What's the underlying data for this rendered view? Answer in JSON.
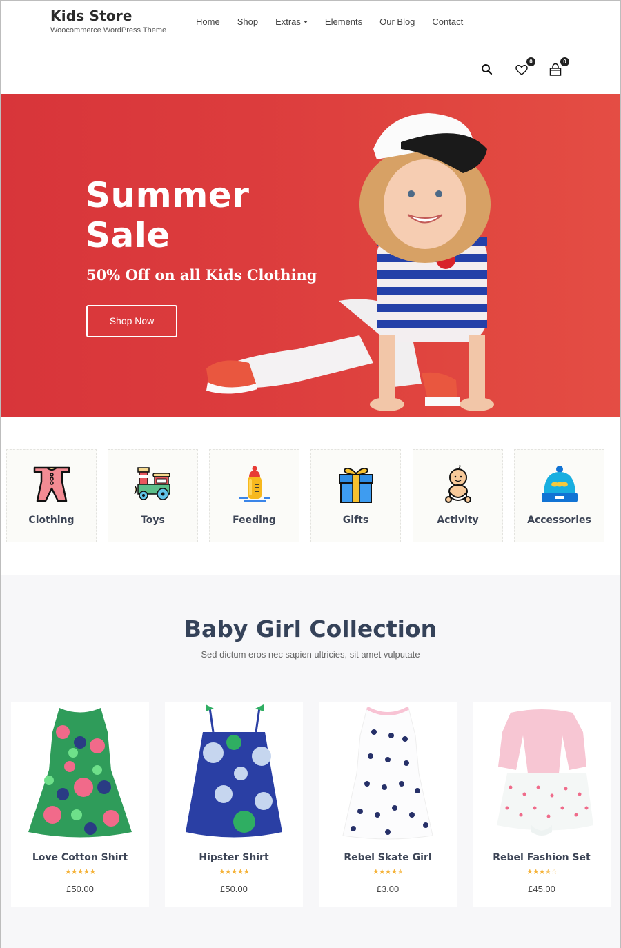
{
  "brand": {
    "title": "Kids Store",
    "subtitle": "Woocommerce WordPress Theme"
  },
  "nav": [
    {
      "label": "Home"
    },
    {
      "label": "Shop"
    },
    {
      "label": "Extras",
      "has_dropdown": true
    },
    {
      "label": "Elements"
    },
    {
      "label": "Our Blog"
    },
    {
      "label": "Contact"
    }
  ],
  "header_icons": {
    "search": "search-icon",
    "wishlist": {
      "icon": "heart-icon",
      "count": "0"
    },
    "cart": {
      "icon": "shopping-bag-icon",
      "count": "0"
    }
  },
  "hero": {
    "title_line1": "Summer",
    "title_line2": "Sale",
    "subtitle": "50% Off on all Kids Clothing",
    "button": "Shop Now",
    "background_color": "#dc3c3d"
  },
  "categories": [
    {
      "label": "Clothing",
      "icon": "onesie-icon"
    },
    {
      "label": "Toys",
      "icon": "toy-train-icon"
    },
    {
      "label": "Feeding",
      "icon": "baby-bottle-icon"
    },
    {
      "label": "Gifts",
      "icon": "gift-box-icon"
    },
    {
      "label": "Activity",
      "icon": "baby-icon"
    },
    {
      "label": "Accessories",
      "icon": "beanie-hat-icon"
    }
  ],
  "collection": {
    "title": "Baby Girl Collection",
    "subtitle": "Sed dictum eros nec sapien ultricies, sit amet vulputate",
    "products": [
      {
        "name": "Love Cotton Shirt",
        "rating": 5,
        "price": "£50.00"
      },
      {
        "name": "Hipster Shirt",
        "rating": 5,
        "price": "£50.00"
      },
      {
        "name": "Rebel Skate Girl",
        "rating": 4.5,
        "price": "£3.00"
      },
      {
        "name": "Rebel Fashion Set",
        "rating": 3.5,
        "price": "£45.00"
      }
    ]
  },
  "colors": {
    "accent": "#dc3c3d",
    "heading": "#354259",
    "star": "#f5b33a"
  }
}
